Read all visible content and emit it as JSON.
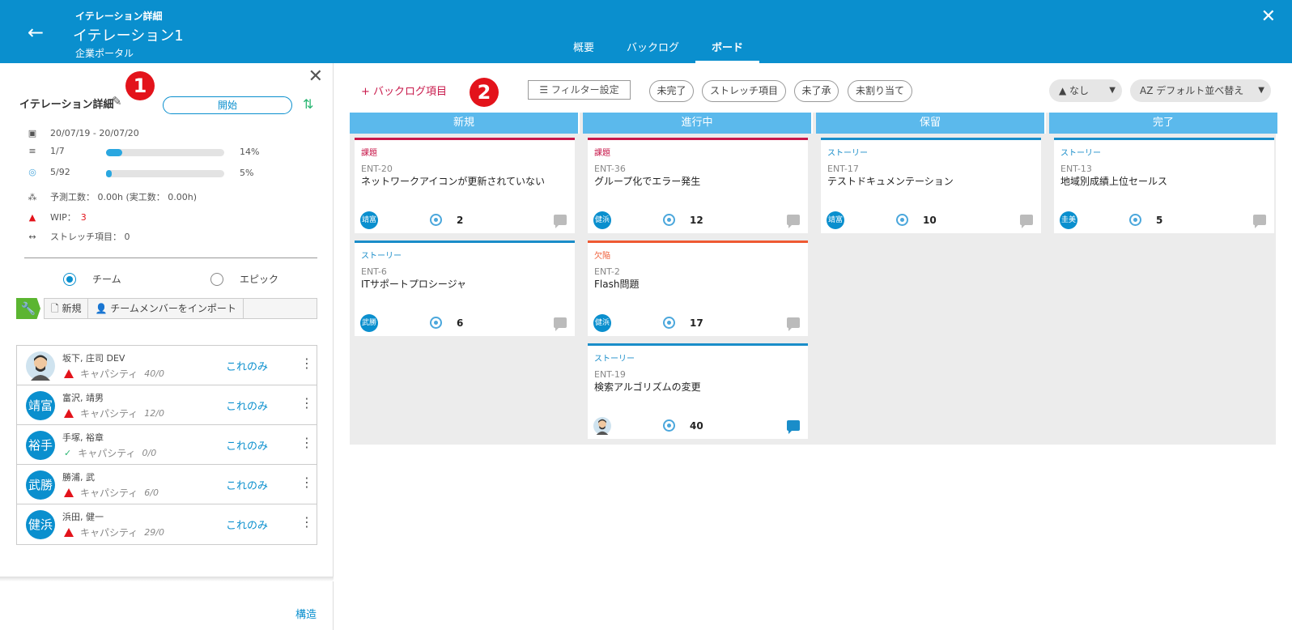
{
  "header": {
    "subtitle": "イテレーション詳細",
    "title": "イテレーション1",
    "project": "企業ポータル",
    "tabs": [
      "概要",
      "バックログ",
      "ボード"
    ]
  },
  "left": {
    "label": "イテレーション詳細",
    "badge": "1",
    "start_label": "開始",
    "date_range": "20/07/19 - 20/07/20",
    "progress1_label": "1/7",
    "progress1_pct": "14%",
    "progress1_value": 14,
    "progress2_label": "5/92",
    "progress2_pct": "5%",
    "progress2_value": 5,
    "estimate": "予測工数： 0.00h (実工数： 0.00h)",
    "wip_label": "WIP：",
    "wip_value": "3",
    "stretch": "ストレッチ項目： 0",
    "radio_team": "チーム",
    "radio_epic": "エピック",
    "tb_new": "新規",
    "tb_import": "チームメンバーをインポート",
    "members": [
      {
        "initials": "",
        "name": "坂下, 庄司 DEV",
        "cap_label": "キャパシティ",
        "cap": "40/0",
        "status": "warn"
      },
      {
        "initials": "靖富",
        "name": "富沢, 靖男",
        "cap_label": "キャパシティ",
        "cap": "12/0",
        "status": "warn"
      },
      {
        "initials": "裕手",
        "name": "手塚, 裕章",
        "cap_label": "キャパシティ",
        "cap": "0/0",
        "status": "ok"
      },
      {
        "initials": "武勝",
        "name": "勝浦, 武",
        "cap_label": "キャパシティ",
        "cap": "6/0",
        "status": "warn"
      },
      {
        "initials": "健浜",
        "name": "浜田, 健一",
        "cap_label": "キャパシティ",
        "cap": "29/0",
        "status": "warn"
      }
    ],
    "only_label": "これのみ",
    "structure_label": "構造"
  },
  "board_toolbar": {
    "add_item": "+ バックログ項目",
    "badge": "2",
    "filter": "フィルター設定",
    "pills": [
      "未完了",
      "ストレッチ項目",
      "未了承",
      "未割り当て"
    ],
    "group": "なし",
    "sort": "デフォルト並べ替え"
  },
  "columns": [
    {
      "title": "新規",
      "cards": [
        {
          "kind": "issue",
          "type": "課題",
          "id": "ENT-20",
          "title": "ネットワークアイコンが更新されていない",
          "avatar": "靖富",
          "points": "2",
          "comment_active": false
        },
        {
          "kind": "story",
          "type": "ストーリー",
          "id": "ENT-6",
          "title": "ITサポートプロシージャ",
          "avatar": "武勝",
          "points": "6",
          "comment_active": false
        }
      ]
    },
    {
      "title": "進行中",
      "cards": [
        {
          "kind": "issue",
          "type": "課題",
          "id": "ENT-36",
          "title": "グループ化でエラー発生",
          "avatar": "健浜",
          "points": "12",
          "comment_active": false
        },
        {
          "kind": "defect",
          "type": "欠陥",
          "id": "ENT-2",
          "title": "Flash問題",
          "avatar": "健浜",
          "points": "17",
          "comment_active": false
        },
        {
          "kind": "story",
          "type": "ストーリー",
          "id": "ENT-19",
          "title": "検索アルゴリズムの変更",
          "avatar": "",
          "points": "40",
          "comment_active": true
        }
      ]
    },
    {
      "title": "保留",
      "cards": [
        {
          "kind": "story",
          "type": "ストーリー",
          "id": "ENT-17",
          "title": "テストドキュメンテーション",
          "avatar": "靖富",
          "points": "10",
          "comment_active": false
        }
      ]
    },
    {
      "title": "完了",
      "cards": [
        {
          "kind": "story",
          "type": "ストーリー",
          "id": "ENT-13",
          "title": "地域別成績上位セールス",
          "avatar": "圭美",
          "points": "5",
          "comment_active": false
        }
      ]
    }
  ],
  "colors": {
    "header": "#0a8fce",
    "issue": "#c8194b",
    "story": "#1a8dc9",
    "defect": "#ef5a33",
    "badge": "#e3131b"
  }
}
